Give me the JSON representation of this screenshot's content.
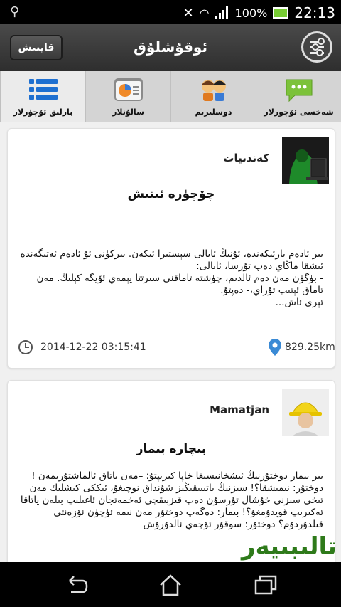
{
  "status": {
    "battery": "100%",
    "time": "22:13"
  },
  "appbar": {
    "back_label": "قايتىش",
    "title": "ئوقۇشلۇق"
  },
  "tabs": [
    {
      "label": "بارلىق ئۆچۈرلار",
      "icon": "list-icon",
      "active": true
    },
    {
      "label": "سالۇنلار",
      "icon": "salon-icon",
      "active": false
    },
    {
      "label": "دوسلىرىم",
      "icon": "friends-icon",
      "active": false
    },
    {
      "label": "شەخسى ئۆچۈرلار",
      "icon": "chat-icon",
      "active": false
    }
  ],
  "posts": [
    {
      "author": "كەندىيات",
      "title": "چۆچۈرە ئىتىش",
      "body": "بىر ئادەم بارئىكەندە، ئۇنىڭ ئايالى سېستىرا ئىكەن. بىركۈنى ئۇ ئادەم ئەتىگەندە ئىشقا ماڭاي دەپ تۇرسا، ئايالى:\n- بۈگۈن مەن دەم ئالدىم، چۈشتە تاماقنى سىرتتا يېمەي ئۆيگە كېلىڭ. مەن تاماق ئېتىپ تۇراي،- دەپتۇ.\nئېرى ئاش...",
      "timestamp": "2014-12-22 03:15:41",
      "distance": "829.25km"
    },
    {
      "author": "Mamatjan",
      "title": "بىچارە بىمار",
      "body": "بىر بىمار دوختۇرنىڭ ئىشخانىسىغا خاپا كىرىپتۇ؛ –مەن ياتاق ئالماشتۇرىمەن !\nدوختۇر: نىمىشقا؟! سىزنىڭ ياتىبىقىڭىز شۇنداق نوچىغۇ، ئىككى كىشلىك مەن تىخى سىزنى خۇشال تۇرسۇن دەپ قىزبىقچى ئەخمەتجان ئاغىلىپ بىلەن ياتاقا ئەكىرىپ قويدۇمغۇ؟! بىمار: دەگەپ دوختۇر مەن نىمە ئۈچۈن ئۆزەنتى قىلدۇردۇم؟ دوختۇر: سوقۇر ئۆچەي ئالدۇرۇش"
    }
  ],
  "watermark": "تالىبىيەر"
}
